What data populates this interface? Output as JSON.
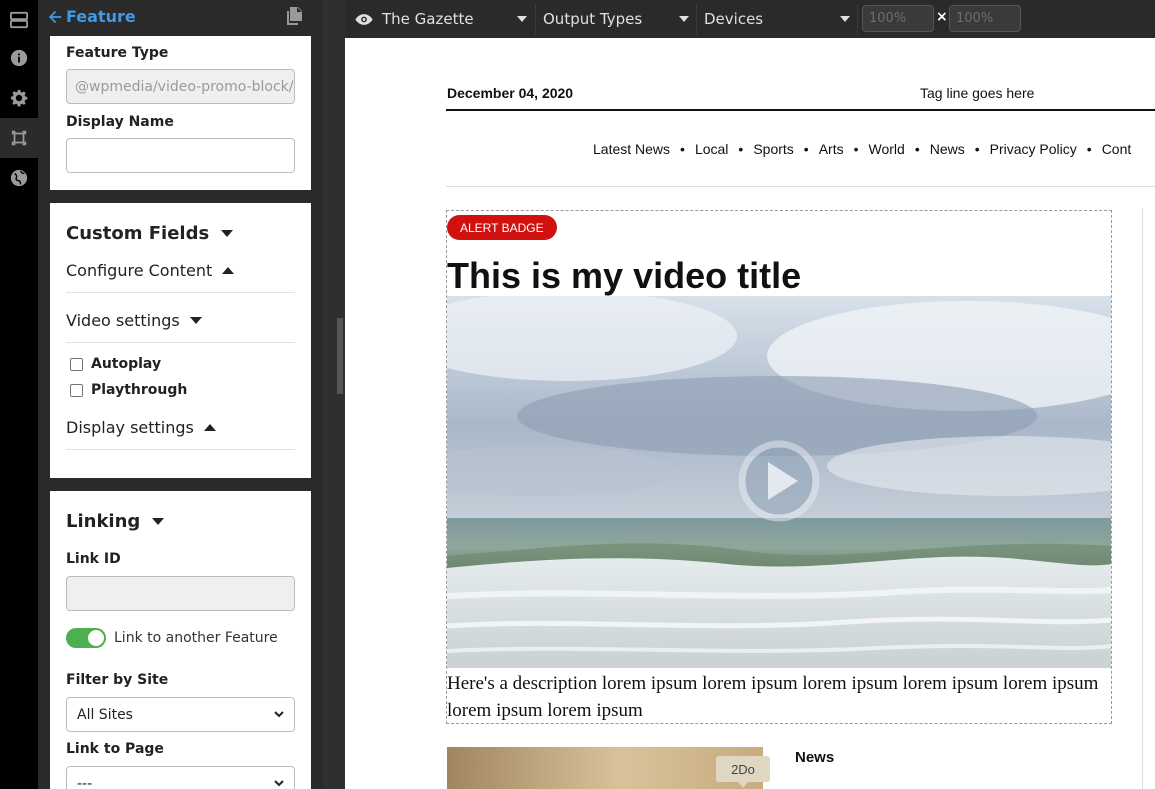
{
  "rail": {
    "icons": [
      "layout-icon",
      "info-icon",
      "gear-icon",
      "feature-frame-icon",
      "globe-icon"
    ]
  },
  "editor": {
    "back_label": "Feature",
    "feature_card": {
      "feature_type_label": "Feature Type",
      "feature_type_value": "@wpmedia/video-promo-block/v",
      "display_name_label": "Display Name",
      "display_name_value": ""
    },
    "custom_fields": {
      "title": "Custom Fields",
      "configure_content": "Configure Content",
      "video_settings": "Video settings",
      "autoplay": "Autoplay",
      "playthrough": "Playthrough",
      "display_settings": "Display settings"
    },
    "linking": {
      "title": "Linking",
      "link_id_label": "Link ID",
      "link_id_value": "",
      "toggle_label": "Link to another Feature",
      "filter_label": "Filter by Site",
      "filter_value": "All Sites",
      "link_page_label": "Link to Page",
      "link_page_value": "---"
    }
  },
  "toolbar": {
    "site": "The Gazette",
    "output_types": "Output Types",
    "devices": "Devices",
    "width_value": "100%",
    "height_value": "100%",
    "times": "×"
  },
  "preview": {
    "date": "December 04, 2020",
    "tagline": "Tag line goes here",
    "nav": [
      "Latest News",
      "Local",
      "Sports",
      "Arts",
      "World",
      "News",
      "Privacy Policy",
      "Cont"
    ],
    "nav_separator": "•",
    "badge": "ALERT BADGE",
    "video_title": "This is my video title",
    "description": "Here's a description lorem ipsum lorem ipsum lorem ipsum lorem ipsum lorem ipsum lorem ipsum lorem ipsum",
    "news_label": "News",
    "tooltip": "2Do"
  },
  "colors": {
    "accent_blue": "#3f9ae6",
    "badge_red": "#d11010",
    "toggle_green": "#4caf50"
  }
}
